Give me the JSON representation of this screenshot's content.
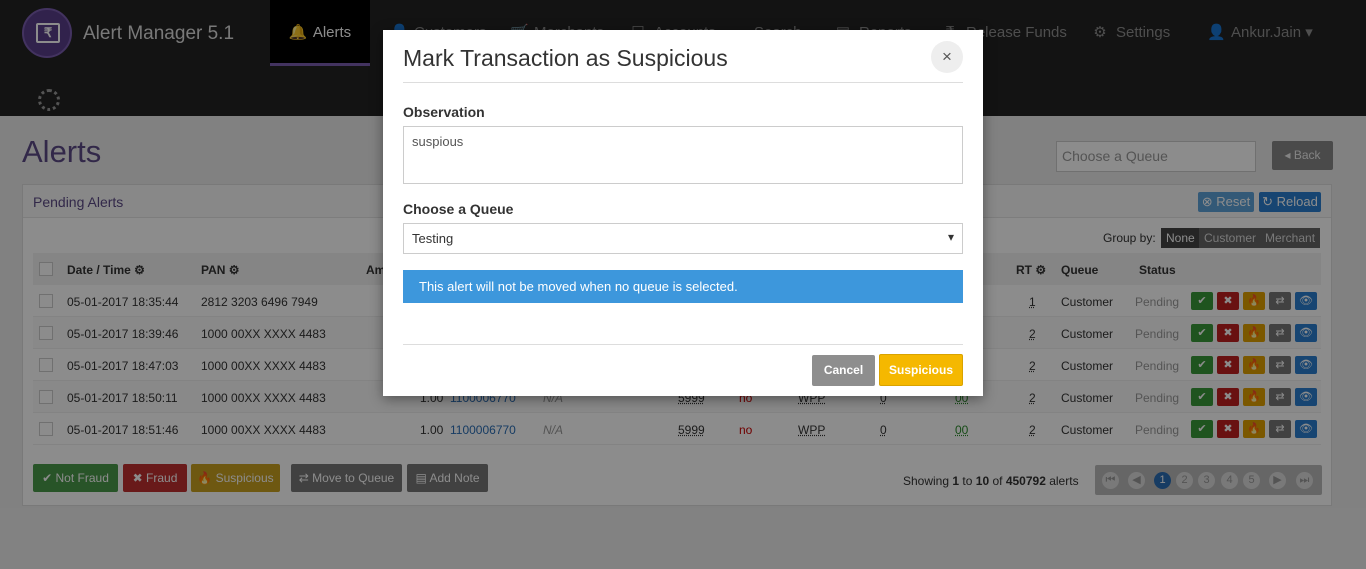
{
  "brand": {
    "title": "Alert Manager 5.1",
    "logo_glyph": "₹"
  },
  "nav": {
    "items": [
      {
        "label": "Alerts",
        "icon": "bell-icon",
        "glyph": "🔔"
      },
      {
        "label": "Customers",
        "icon": "user-icon",
        "glyph": "👤"
      },
      {
        "label": "Merchants",
        "icon": "cart-icon",
        "glyph": "🛒"
      },
      {
        "label": "Accounts",
        "icon": "square-icon",
        "glyph": "☐"
      },
      {
        "label": "Search",
        "icon": "search-icon",
        "glyph": "⌕"
      },
      {
        "label": "Reports",
        "icon": "list-icon",
        "glyph": "▤"
      },
      {
        "label": "Release Funds",
        "icon": "rupee-icon",
        "glyph": "₹"
      },
      {
        "label": "Settings",
        "icon": "gear-icon",
        "glyph": "⚙"
      },
      {
        "label": "Ankur.Jain",
        "icon": "user-icon",
        "glyph": "👤",
        "caret": "▾"
      }
    ]
  },
  "page": {
    "title": "Alerts",
    "queue_placeholder": "Choose a Queue",
    "back_label": "◂ Back"
  },
  "panel": {
    "title": "Pending Alerts",
    "reset_label": "⊗ Reset",
    "reload_label": "↻ Reload",
    "group_by_label": "Group by:",
    "group_options": [
      "None",
      "Customer",
      "Merchant"
    ],
    "group_selected": "None",
    "columns": [
      "Date / Time ⚙",
      "PAN ⚙",
      "Am",
      "RT ⚙",
      "Queue",
      "Status"
    ],
    "rows": [
      {
        "date": "05-01-2017 18:35:44",
        "pan": "2812 3203 6496 7949",
        "amount": "",
        "id": "",
        "na": "",
        "mcc": "",
        "flag": "",
        "type": "",
        "z": "",
        "g": "",
        "rt": "1",
        "queue": "Customer",
        "status": "Pending"
      },
      {
        "date": "05-01-2017 18:39:46",
        "pan": "1000 00XX XXXX 4483",
        "amount": "",
        "id": "",
        "na": "",
        "mcc": "",
        "flag": "",
        "type": "",
        "z": "",
        "g": "",
        "rt": "2",
        "queue": "Customer",
        "status": "Pending"
      },
      {
        "date": "05-01-2017 18:47:03",
        "pan": "1000 00XX XXXX 4483",
        "amount": "",
        "id": "",
        "na": "",
        "mcc": "",
        "flag": "",
        "type": "",
        "z": "",
        "g": "",
        "rt": "2",
        "queue": "Customer",
        "status": "Pending"
      },
      {
        "date": "05-01-2017 18:50:11",
        "pan": "1000 00XX XXXX 4483",
        "amount": "1.00",
        "id": "1100006770",
        "na": "N/A",
        "mcc": "5999",
        "flag": "no",
        "type": "WPP",
        "z": "0",
        "g": "00",
        "rt": "2",
        "queue": "Customer",
        "status": "Pending"
      },
      {
        "date": "05-01-2017 18:51:46",
        "pan": "1000 00XX XXXX 4483",
        "amount": "1.00",
        "id": "1100006770",
        "na": "N/A",
        "mcc": "5999",
        "flag": "no",
        "type": "WPP",
        "z": "0",
        "g": "00",
        "rt": "2",
        "queue": "Customer",
        "status": "Pending"
      }
    ],
    "action_glyphs": [
      "✔",
      "✖",
      "🔥",
      "⇄",
      "👁"
    ],
    "bottom_buttons": [
      {
        "label": "✔ Not Fraud",
        "color": "#4a9a4a"
      },
      {
        "label": "✖ Fraud",
        "color": "#c03030"
      },
      {
        "label": "🔥 Suspicious",
        "color": "#c8a020"
      },
      {
        "label": "⇄ Move to Queue",
        "color": "#777777"
      },
      {
        "label": "▤ Add Note",
        "color": "#777777"
      }
    ],
    "showing_prefix": "Showing",
    "showing_from": "1",
    "showing_to_word": "to",
    "showing_to": "10",
    "showing_of_word": "of",
    "showing_total": "450792",
    "showing_suffix": "alerts",
    "pages": [
      "1",
      "2",
      "3",
      "4",
      "5"
    ],
    "current_page": "1"
  },
  "modal": {
    "title": "Mark Transaction as Suspicious",
    "close_glyph": "×",
    "observation_label": "Observation",
    "observation_value": "suspious",
    "queue_label": "Choose a Queue",
    "queue_value": "Testing",
    "info_text": "This alert will not be moved when no queue is selected.",
    "cancel_label": "Cancel",
    "submit_label": "Suspicious"
  },
  "colors": {
    "accent": "#5b4a86",
    "info": "#3d97dc",
    "warning": "#f5b800"
  }
}
